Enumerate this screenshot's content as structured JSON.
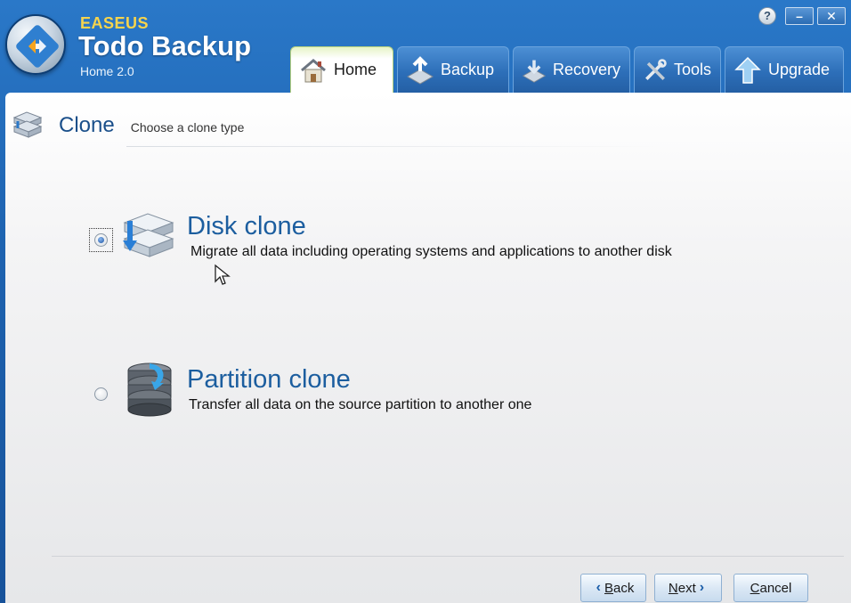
{
  "app": {
    "brand_small": "EASEUS",
    "brand_large": "Todo Backup",
    "edition": "Home 2.0"
  },
  "window_controls": {
    "help": "?",
    "minimize": "–",
    "close": "✕"
  },
  "tabs": [
    {
      "label": "Home",
      "icon": "home-icon",
      "active": true
    },
    {
      "label": "Backup",
      "icon": "backup-icon",
      "active": false
    },
    {
      "label": "Recovery",
      "icon": "recovery-icon",
      "active": false
    },
    {
      "label": "Tools",
      "icon": "tools-icon",
      "active": false
    },
    {
      "label": "Upgrade",
      "icon": "upgrade-icon",
      "active": false
    }
  ],
  "page": {
    "title": "Clone",
    "subtitle": "Choose a clone type"
  },
  "options": [
    {
      "title": "Disk clone",
      "description": "Migrate all data including operating systems and applications to another disk",
      "selected": true
    },
    {
      "title": "Partition clone",
      "description": "Transfer all data on the source partition to another one",
      "selected": false
    }
  ],
  "buttons": {
    "back_mnemonic": "B",
    "back_rest": "ack",
    "next_mnemonic": "N",
    "next_rest": "ext",
    "cancel_mnemonic": "C",
    "cancel_rest": "ancel"
  },
  "colors": {
    "accent_blue": "#1c5e9f",
    "title_bar": "#2a78c8",
    "brand_yellow": "#f7d44c"
  }
}
